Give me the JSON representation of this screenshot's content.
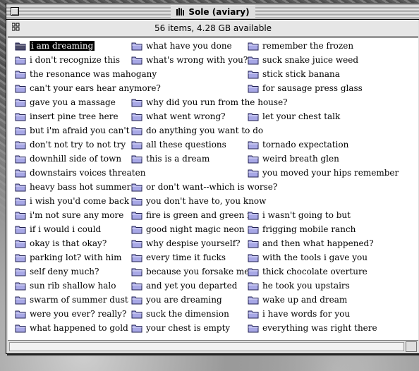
{
  "window": {
    "title": "Sole (aviary)",
    "info": "56 items, 4.28 GB available"
  },
  "icons": {
    "title": "folder-stripes-icon",
    "info": "folder-info-icon",
    "items": "folder-icon"
  },
  "columns": [
    [
      "i am dreaming",
      "i don't recognize this",
      "the resonance was mahogany",
      "can't your ears hear anymore?",
      "gave you a massage",
      "insert pine tree here",
      "but i'm afraid you can't",
      "don't not try to not try",
      "downhill side of town",
      "downstairs voices threaten",
      "heavy bass hot summer",
      "i wish you'd come back",
      "i'm not sure any more",
      "if i would i could",
      "okay is that okay?",
      "parking lot? with him",
      "self deny much?",
      "sun rib shallow halo",
      "swarm of summer dust",
      "were you ever? really?",
      "what happened to gold"
    ],
    [
      "what have you done",
      "what's wrong with you?",
      "",
      "",
      "why did you run from the house?",
      "what went wrong?",
      "do anything you want to do",
      "all these questions",
      "this is a dream",
      "",
      "or don't want--which is worse?",
      "you don't have to, you know",
      "fire is green and green is",
      "good night magic neon",
      "why despise yourself?",
      "every time it fucks",
      "because you forsake me",
      "and yet you departed",
      "you are dreaming",
      "suck the dimension",
      "your chest is empty"
    ],
    [
      "remember the frozen",
      "suck snake juice weed",
      "stick stick banana",
      "for sausage press glass",
      "",
      "let your chest talk",
      "",
      "tornado expectation",
      "weird breath glen",
      "you moved your hips remember",
      "",
      "",
      "i wasn't going to but",
      "frigging mobile ranch",
      "and then what happened?",
      "with the tools i gave you",
      "thick chocolate overture",
      "he took you upstairs",
      "wake up and dream",
      "i have words for you",
      "everything was right there"
    ]
  ],
  "selected": "i am dreaming"
}
